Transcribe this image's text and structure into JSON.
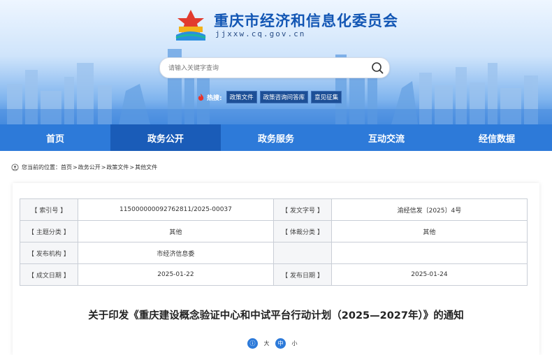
{
  "header": {
    "site_title": "重庆市经济和信息化委员会",
    "site_domain": "jjxxw.cq.gov.cn"
  },
  "search": {
    "placeholder": "请输入关键字查询"
  },
  "hot_search": {
    "label": "热搜:",
    "items": [
      "政策文件",
      "政策咨询问答库",
      "意见征集"
    ]
  },
  "nav": {
    "items": [
      "首页",
      "政务公开",
      "政务服务",
      "互动交流",
      "经信数据"
    ],
    "active_index": 1
  },
  "breadcrumb": {
    "prefix": "您当前的位置：",
    "items": [
      "首页",
      "政务公开",
      "政策文件",
      "其他文件"
    ]
  },
  "meta_table": {
    "rows": [
      {
        "label1": "【 索引号 】",
        "value1": "115000000092762811/2025-00037",
        "label2": "【 发文字号 】",
        "value2": "渝经信发〔2025〕4号"
      },
      {
        "label1": "【 主题分类 】",
        "value1": "其他",
        "label2": "【 体裁分类 】",
        "value2": "其他"
      },
      {
        "label1": "【 发布机构 】",
        "value1": "市经济信息委",
        "label2": "",
        "value2": ""
      },
      {
        "label1": "【 成文日期 】",
        "value1": "2025-01-22",
        "label2": "【 发布日期 】",
        "value2": "2025-01-24"
      }
    ]
  },
  "document": {
    "title": "关于印发《重庆建设概念验证中心和中试平台行动计划（2025—2027年）》的通知"
  },
  "font_size": {
    "buttons": [
      "ⓘ",
      "大",
      "中",
      "小"
    ]
  },
  "colors": {
    "nav_bg": "#2d7ad9",
    "nav_active": "#1a5cb8",
    "title_blue": "#1256b4"
  }
}
